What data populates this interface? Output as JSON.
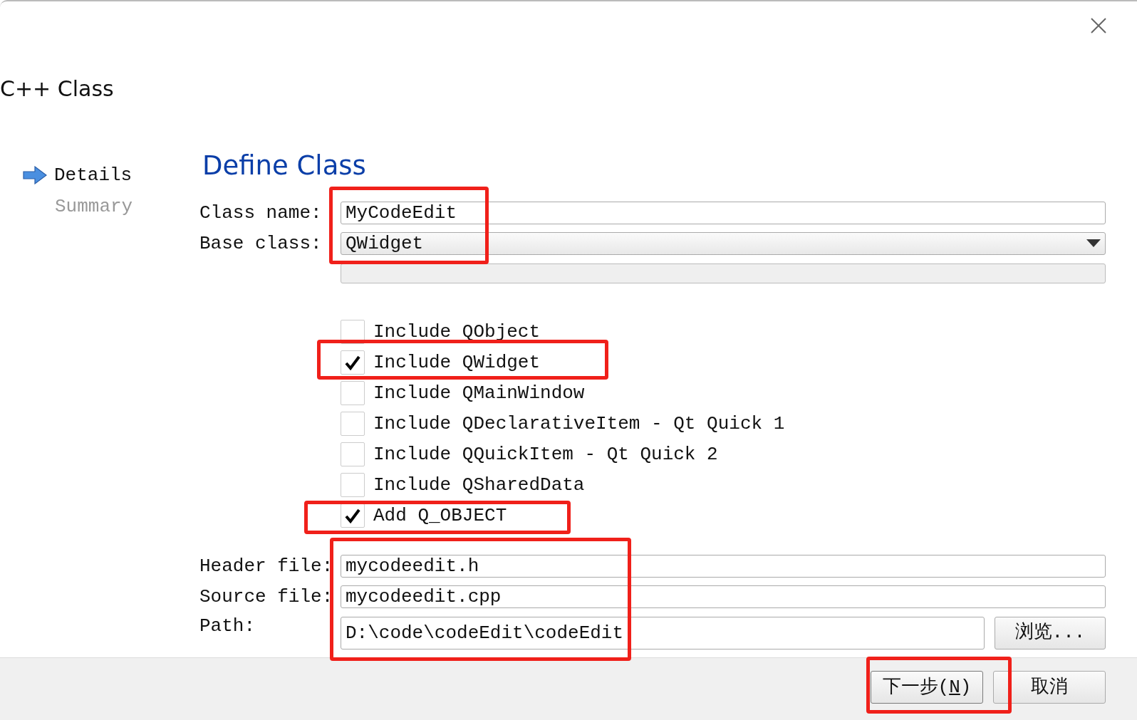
{
  "window": {
    "title": "C++ Class"
  },
  "steps": [
    {
      "label": "Details",
      "selected": true
    },
    {
      "label": "Summary",
      "selected": false
    }
  ],
  "page": {
    "title": "Define Class"
  },
  "class_name": {
    "label": "Class name:",
    "value": "MyCodeEdit"
  },
  "base_class": {
    "label": "Base class:",
    "value": "QWidget"
  },
  "options": [
    {
      "label": "Include QObject",
      "checked": false
    },
    {
      "label": "Include QWidget",
      "checked": true
    },
    {
      "label": "Include QMainWindow",
      "checked": false
    },
    {
      "label": "Include QDeclarativeItem - Qt Quick 1",
      "checked": false
    },
    {
      "label": "Include QQuickItem - Qt Quick 2",
      "checked": false
    },
    {
      "label": "Include QSharedData",
      "checked": false
    },
    {
      "label": "Add Q_OBJECT",
      "checked": true
    }
  ],
  "header_file": {
    "label": "Header file:",
    "value": "mycodeedit.h"
  },
  "source_file": {
    "label": "Source file:",
    "value": "mycodeedit.cpp"
  },
  "path": {
    "label": "Path:",
    "value": "D:\\code\\codeEdit\\codeEdit",
    "browse": "浏览..."
  },
  "buttons": [
    {
      "label": "下一步(",
      "mnemonic": "N",
      "suffix": ")",
      "kind": "primary"
    },
    {
      "label": "取消",
      "kind": "plain"
    }
  ],
  "annotation_boxes": [
    {
      "kind": "class-fields"
    },
    {
      "kind": "include-widget"
    },
    {
      "kind": "add-qobject"
    },
    {
      "kind": "file-fields"
    },
    {
      "kind": "next-button"
    }
  ]
}
